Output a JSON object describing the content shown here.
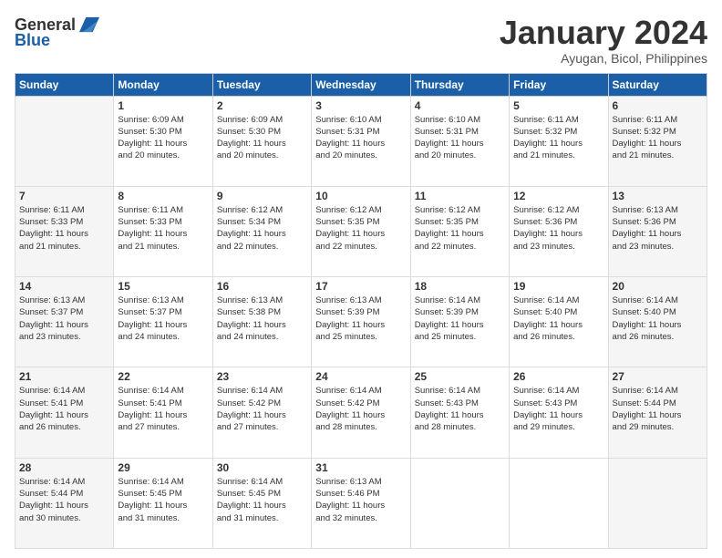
{
  "logo": {
    "general": "General",
    "blue": "Blue"
  },
  "title": "January 2024",
  "subtitle": "Ayugan, Bicol, Philippines",
  "headers": [
    "Sunday",
    "Monday",
    "Tuesday",
    "Wednesday",
    "Thursday",
    "Friday",
    "Saturday"
  ],
  "weeks": [
    [
      {
        "day": "",
        "info": ""
      },
      {
        "day": "1",
        "info": "Sunrise: 6:09 AM\nSunset: 5:30 PM\nDaylight: 11 hours\nand 20 minutes."
      },
      {
        "day": "2",
        "info": "Sunrise: 6:09 AM\nSunset: 5:30 PM\nDaylight: 11 hours\nand 20 minutes."
      },
      {
        "day": "3",
        "info": "Sunrise: 6:10 AM\nSunset: 5:31 PM\nDaylight: 11 hours\nand 20 minutes."
      },
      {
        "day": "4",
        "info": "Sunrise: 6:10 AM\nSunset: 5:31 PM\nDaylight: 11 hours\nand 20 minutes."
      },
      {
        "day": "5",
        "info": "Sunrise: 6:11 AM\nSunset: 5:32 PM\nDaylight: 11 hours\nand 21 minutes."
      },
      {
        "day": "6",
        "info": "Sunrise: 6:11 AM\nSunset: 5:32 PM\nDaylight: 11 hours\nand 21 minutes."
      }
    ],
    [
      {
        "day": "7",
        "info": "Sunrise: 6:11 AM\nSunset: 5:33 PM\nDaylight: 11 hours\nand 21 minutes."
      },
      {
        "day": "8",
        "info": "Sunrise: 6:11 AM\nSunset: 5:33 PM\nDaylight: 11 hours\nand 21 minutes."
      },
      {
        "day": "9",
        "info": "Sunrise: 6:12 AM\nSunset: 5:34 PM\nDaylight: 11 hours\nand 22 minutes."
      },
      {
        "day": "10",
        "info": "Sunrise: 6:12 AM\nSunset: 5:35 PM\nDaylight: 11 hours\nand 22 minutes."
      },
      {
        "day": "11",
        "info": "Sunrise: 6:12 AM\nSunset: 5:35 PM\nDaylight: 11 hours\nand 22 minutes."
      },
      {
        "day": "12",
        "info": "Sunrise: 6:12 AM\nSunset: 5:36 PM\nDaylight: 11 hours\nand 23 minutes."
      },
      {
        "day": "13",
        "info": "Sunrise: 6:13 AM\nSunset: 5:36 PM\nDaylight: 11 hours\nand 23 minutes."
      }
    ],
    [
      {
        "day": "14",
        "info": "Sunrise: 6:13 AM\nSunset: 5:37 PM\nDaylight: 11 hours\nand 23 minutes."
      },
      {
        "day": "15",
        "info": "Sunrise: 6:13 AM\nSunset: 5:37 PM\nDaylight: 11 hours\nand 24 minutes."
      },
      {
        "day": "16",
        "info": "Sunrise: 6:13 AM\nSunset: 5:38 PM\nDaylight: 11 hours\nand 24 minutes."
      },
      {
        "day": "17",
        "info": "Sunrise: 6:13 AM\nSunset: 5:39 PM\nDaylight: 11 hours\nand 25 minutes."
      },
      {
        "day": "18",
        "info": "Sunrise: 6:14 AM\nSunset: 5:39 PM\nDaylight: 11 hours\nand 25 minutes."
      },
      {
        "day": "19",
        "info": "Sunrise: 6:14 AM\nSunset: 5:40 PM\nDaylight: 11 hours\nand 26 minutes."
      },
      {
        "day": "20",
        "info": "Sunrise: 6:14 AM\nSunset: 5:40 PM\nDaylight: 11 hours\nand 26 minutes."
      }
    ],
    [
      {
        "day": "21",
        "info": "Sunrise: 6:14 AM\nSunset: 5:41 PM\nDaylight: 11 hours\nand 26 minutes."
      },
      {
        "day": "22",
        "info": "Sunrise: 6:14 AM\nSunset: 5:41 PM\nDaylight: 11 hours\nand 27 minutes."
      },
      {
        "day": "23",
        "info": "Sunrise: 6:14 AM\nSunset: 5:42 PM\nDaylight: 11 hours\nand 27 minutes."
      },
      {
        "day": "24",
        "info": "Sunrise: 6:14 AM\nSunset: 5:42 PM\nDaylight: 11 hours\nand 28 minutes."
      },
      {
        "day": "25",
        "info": "Sunrise: 6:14 AM\nSunset: 5:43 PM\nDaylight: 11 hours\nand 28 minutes."
      },
      {
        "day": "26",
        "info": "Sunrise: 6:14 AM\nSunset: 5:43 PM\nDaylight: 11 hours\nand 29 minutes."
      },
      {
        "day": "27",
        "info": "Sunrise: 6:14 AM\nSunset: 5:44 PM\nDaylight: 11 hours\nand 29 minutes."
      }
    ],
    [
      {
        "day": "28",
        "info": "Sunrise: 6:14 AM\nSunset: 5:44 PM\nDaylight: 11 hours\nand 30 minutes."
      },
      {
        "day": "29",
        "info": "Sunrise: 6:14 AM\nSunset: 5:45 PM\nDaylight: 11 hours\nand 31 minutes."
      },
      {
        "day": "30",
        "info": "Sunrise: 6:14 AM\nSunset: 5:45 PM\nDaylight: 11 hours\nand 31 minutes."
      },
      {
        "day": "31",
        "info": "Sunrise: 6:13 AM\nSunset: 5:46 PM\nDaylight: 11 hours\nand 32 minutes."
      },
      {
        "day": "",
        "info": ""
      },
      {
        "day": "",
        "info": ""
      },
      {
        "day": "",
        "info": ""
      }
    ]
  ]
}
